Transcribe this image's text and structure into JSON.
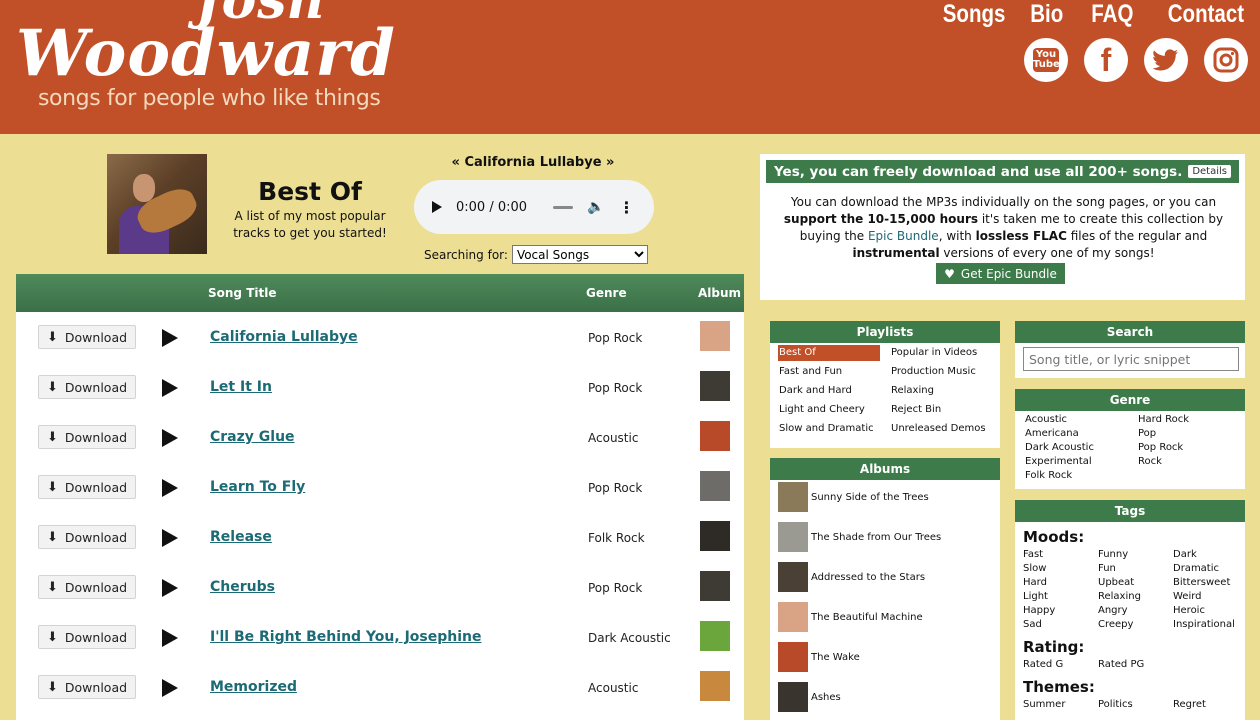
{
  "header": {
    "logo_line1": "Josh",
    "logo_line2": "Woodward",
    "tagline": "songs for people who like things",
    "nav": [
      "Songs",
      "Bio",
      "FAQ",
      "Contact"
    ],
    "social": [
      {
        "icon": "youtube-icon",
        "label": "You Tube"
      },
      {
        "icon": "facebook-icon",
        "label": "f"
      },
      {
        "icon": "twitter-icon",
        "label": ""
      },
      {
        "icon": "instagram-icon",
        "label": ""
      }
    ]
  },
  "best_of": {
    "title": "Best Of",
    "description": "A list of my most popular tracks to get you started!"
  },
  "player": {
    "now_playing": "« California Lullabye »",
    "time": "0:00 / 0:00"
  },
  "search_for": {
    "label": "Searching for:",
    "selected": "Vocal Songs"
  },
  "song_table": {
    "headers": {
      "title": "Song Title",
      "genre": "Genre",
      "album": "Album"
    },
    "download_label": "Download",
    "rows": [
      {
        "title": "California Lullabye",
        "genre": "Pop Rock",
        "thumb": "#d9a386"
      },
      {
        "title": "Let It In",
        "genre": "Pop Rock",
        "thumb": "#3e3b34"
      },
      {
        "title": "Crazy Glue",
        "genre": "Acoustic",
        "thumb": "#b84a2a"
      },
      {
        "title": "Learn To Fly",
        "genre": "Pop Rock",
        "thumb": "#6e6c68"
      },
      {
        "title": "Release",
        "genre": "Folk Rock",
        "thumb": "#2e2a26"
      },
      {
        "title": "Cherubs",
        "genre": "Pop Rock",
        "thumb": "#3e3b34"
      },
      {
        "title": "I'll Be Right Behind You, Josephine",
        "genre": "Dark Acoustic",
        "thumb": "#6aa63c"
      },
      {
        "title": "Memorized",
        "genre": "Acoustic",
        "thumb": "#c8893e"
      }
    ]
  },
  "promo": {
    "heading": "Yes, you can freely download and use all 200+ songs.",
    "details_label": "Details",
    "text_1": "You can download the MP3s individually on the song pages, or you can ",
    "text_2": "support the 10-15,000 hours",
    "text_3": " it's taken me to create this collection by buying the ",
    "text_4": "Epic Bundle",
    "text_5": ", with ",
    "text_6": "lossless FLAC",
    "text_7": " files of the regular and ",
    "text_8": "instrumental",
    "text_9": " versions of every one of my songs!",
    "button_label": "Get Epic Bundle"
  },
  "playlists": {
    "heading": "Playlists",
    "items": [
      "Best Of",
      "Popular in Videos",
      "Fast and Fun",
      "Production Music",
      "Dark and Hard",
      "Relaxing",
      "Light and Cheery",
      "Reject Bin",
      "Slow and Dramatic",
      "Unreleased Demos"
    ]
  },
  "albums": {
    "heading": "Albums",
    "items": [
      {
        "name": "Sunny Side of the Trees",
        "thumb": "#8a7a5a"
      },
      {
        "name": "The Shade from Our Trees",
        "thumb": "#9a9a92"
      },
      {
        "name": "Addressed to the Stars",
        "thumb": "#4a4036"
      },
      {
        "name": "The Beautiful Machine",
        "thumb": "#d9a386"
      },
      {
        "name": "The Wake",
        "thumb": "#b84a2a"
      },
      {
        "name": "Ashes",
        "thumb": "#3a342e"
      }
    ]
  },
  "search": {
    "heading": "Search",
    "placeholder": "Song title, or lyric snippet"
  },
  "genre": {
    "heading": "Genre",
    "items": [
      "Acoustic",
      "Hard Rock",
      "Americana",
      "Pop",
      "Dark Acoustic",
      "Pop Rock",
      "Experimental",
      "Rock",
      "Folk Rock",
      ""
    ]
  },
  "tags": {
    "heading": "Tags",
    "moods_label": "Moods:",
    "moods": [
      "Fast",
      "Funny",
      "Dark",
      "Slow",
      "Fun",
      "Dramatic",
      "Hard",
      "Upbeat",
      "Bittersweet",
      "Light",
      "Relaxing",
      "Weird",
      "Happy",
      "Angry",
      "Heroic",
      "Sad",
      "Creepy",
      "Inspirational"
    ],
    "rating_label": "Rating:",
    "ratings": [
      "Rated G",
      "Rated PG",
      ""
    ],
    "themes_label": "Themes:",
    "themes": [
      "Summer",
      "Politics",
      "Regret"
    ]
  },
  "colors": {
    "header_bg": "#c14f27",
    "page_bg": "#ecdf93",
    "green": "#3d7b4a",
    "link": "#1c6a75"
  }
}
